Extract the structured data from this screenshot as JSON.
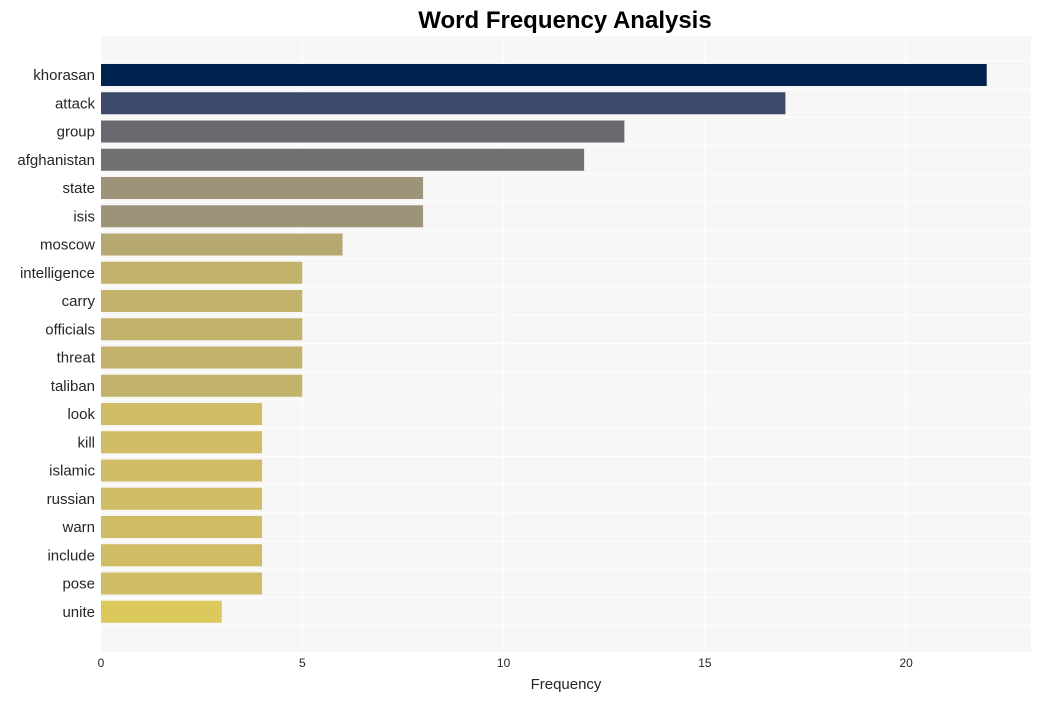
{
  "chart_data": {
    "type": "bar",
    "orientation": "horizontal",
    "title": "Word Frequency Analysis",
    "xlabel": "Frequency",
    "ylabel": "",
    "xlim": [
      0,
      23.1
    ],
    "xticks": [
      0,
      5,
      10,
      15,
      20
    ],
    "grid": true,
    "legend": "none",
    "categories": [
      "khorasan",
      "attack",
      "group",
      "afghanistan",
      "state",
      "isis",
      "moscow",
      "intelligence",
      "carry",
      "officials",
      "threat",
      "taliban",
      "look",
      "kill",
      "islamic",
      "russian",
      "warn",
      "include",
      "pose",
      "unite"
    ],
    "values": [
      22,
      17,
      13,
      12,
      8,
      8,
      6,
      5,
      5,
      5,
      5,
      5,
      4,
      4,
      4,
      4,
      4,
      4,
      4,
      3
    ],
    "colors": [
      "#00224e",
      "#3d4a6b",
      "#696a70",
      "#707173",
      "#9c9378",
      "#9c9378",
      "#b5a870",
      "#c2b26b",
      "#c2b26b",
      "#c2b26b",
      "#c2b26b",
      "#c2b26b",
      "#cfbc64",
      "#cfbc64",
      "#cfbc64",
      "#cfbc64",
      "#cfbc64",
      "#cfbc64",
      "#cfbc64",
      "#dcc95c"
    ]
  },
  "style": {
    "plot_background": "#f7f7f7",
    "grid_color": "#ffffff"
  }
}
